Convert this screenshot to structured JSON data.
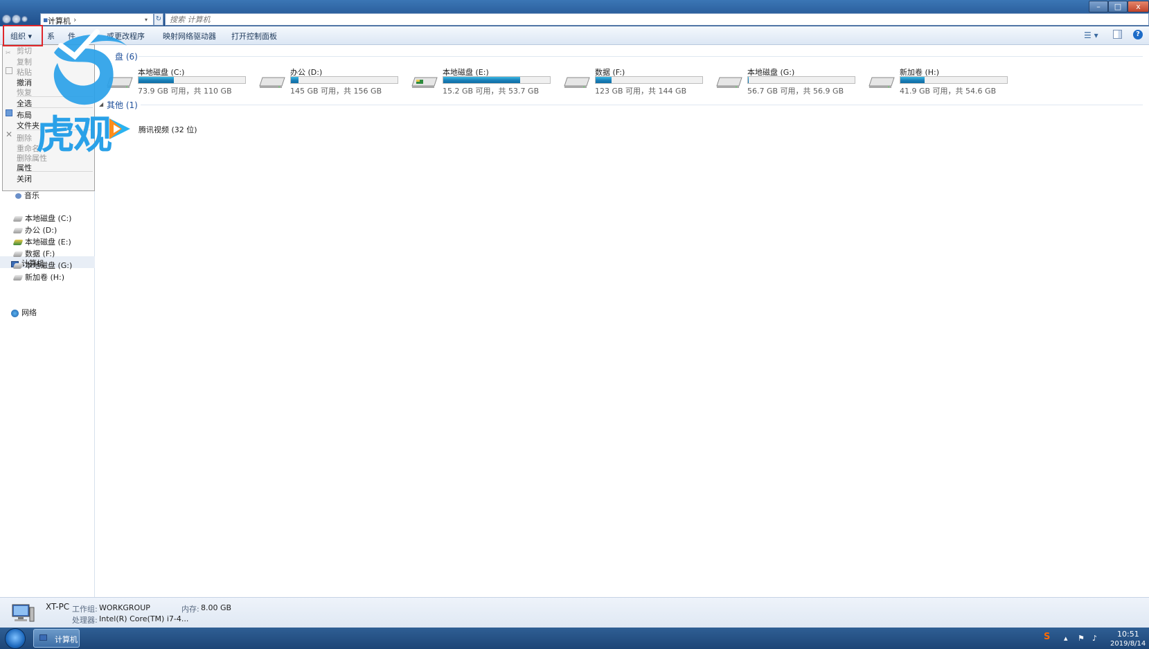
{
  "window": {
    "address_crumb": "计算机",
    "search_placeholder": "搜索 计算机",
    "controls": {
      "minimize": "–",
      "maximize": "□",
      "close": "x"
    }
  },
  "toolbar": {
    "organize": "组织 ▾",
    "system_properties_partial": "系",
    "uninstall_partial": "件",
    "change_program": "或更改程序",
    "map_drive": "映射网络驱动器",
    "control_panel": "打开控制面板"
  },
  "organize_menu": {
    "items": [
      {
        "label": "剪切",
        "enabled": false
      },
      {
        "label": "复制",
        "enabled": false
      },
      {
        "label": "粘贴",
        "enabled": false
      },
      {
        "label": "撤消",
        "enabled": true
      },
      {
        "label": "恢复",
        "enabled": false
      },
      {
        "label": "全选",
        "enabled": true
      },
      {
        "label": "布局",
        "enabled": true
      },
      {
        "label": "文件夹",
        "enabled": true
      },
      {
        "label": "删除",
        "enabled": false
      },
      {
        "label": "重命名",
        "enabled": false
      },
      {
        "label": "删除属性",
        "enabled": false
      },
      {
        "label": "属性",
        "enabled": true
      },
      {
        "label": "关闭",
        "enabled": true
      }
    ],
    "highlight_color": "#e0262b"
  },
  "watermark": {
    "text": "虎观",
    "color": "#2aa1e8"
  },
  "sidebar": {
    "music": "音乐",
    "computer": "计算机",
    "drives": [
      "本地磁盘 (C:)",
      "办公 (D:)",
      "本地磁盘 (E:)",
      "数据 (F:)",
      "本地磁盘 (G:)",
      "新加卷 (H:)"
    ],
    "network": "网络"
  },
  "content": {
    "drives_header": "盘 (6)",
    "other_header": "其他 (1)",
    "drives": [
      {
        "name": "本地磁盘 (C:)",
        "free_text": "73.9 GB 可用，共 110 GB",
        "used_fraction": 0.33
      },
      {
        "name": "办公 (D:)",
        "free_text": "145 GB 可用，共 156 GB",
        "used_fraction": 0.07
      },
      {
        "name": "本地磁盘 (E:)",
        "free_text": "15.2 GB 可用，共 53.7 GB",
        "used_fraction": 0.72
      },
      {
        "name": "数据 (F:)",
        "free_text": "123 GB 可用，共 144 GB",
        "used_fraction": 0.15
      },
      {
        "name": "本地磁盘 (G:)",
        "free_text": "56.7 GB 可用，共 56.9 GB",
        "used_fraction": 0.004
      },
      {
        "name": "新加卷 (H:)",
        "free_text": "41.9 GB 可用，共 54.6 GB",
        "used_fraction": 0.23
      }
    ],
    "other_item": "腾讯视频 (32 位)"
  },
  "details": {
    "pc_name": "XT-PC",
    "workgroup_label": "工作组:",
    "workgroup_value": "WORKGROUP",
    "memory_label": "内存:",
    "memory_value": "8.00 GB",
    "cpu_label": "处理器:",
    "cpu_value": "Intel(R) Core(TM) i7-4..."
  },
  "taskbar": {
    "task_label": "计算机",
    "time": "10:51",
    "date": "2019/8/14",
    "tray_ime": "S",
    "tray_arrow": "▴"
  }
}
